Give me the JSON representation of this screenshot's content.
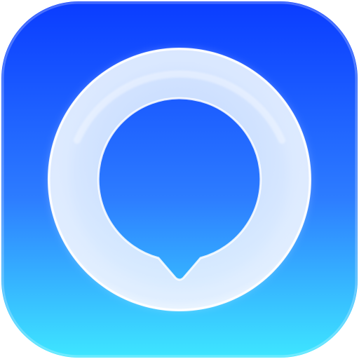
{
  "icon": {
    "name": "chat-bubble-ring-icon",
    "colors": {
      "gradient_top": "#0a3cff",
      "gradient_mid": "#2d7cff",
      "gradient_bottom": "#3ee6ff",
      "ring_light": "#ffffff",
      "ring_tint": "#cfe4ff"
    }
  }
}
